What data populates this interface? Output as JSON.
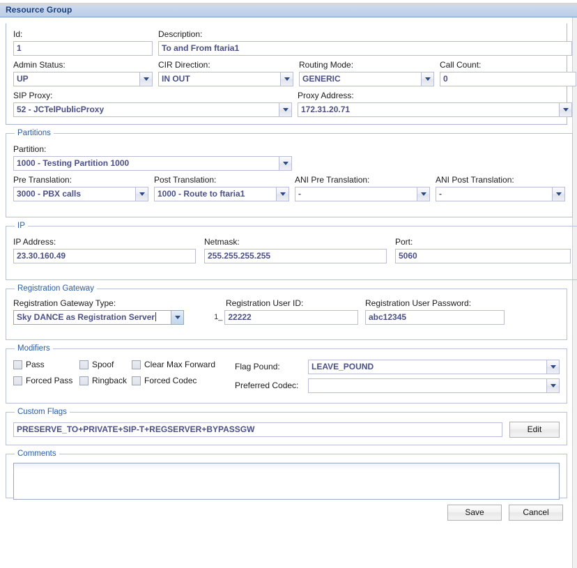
{
  "window": {
    "title": "Resource Group"
  },
  "top": {
    "id_label": "Id:",
    "id_value": "1",
    "description_label": "Description:",
    "description_value": "To and From ftaria1",
    "admin_status_label": "Admin Status:",
    "admin_status_value": "UP",
    "cir_direction_label": "CIR Direction:",
    "cir_direction_value": "IN OUT",
    "routing_mode_label": "Routing Mode:",
    "routing_mode_value": "GENERIC",
    "call_count_label": "Call Count:",
    "call_count_value": "0",
    "sip_proxy_label": "SIP Proxy:",
    "sip_proxy_value": "52 - JCTelPublicProxy",
    "proxy_address_label": "Proxy Address:",
    "proxy_address_value": "172.31.20.71"
  },
  "partitions": {
    "legend": "Partitions",
    "partition_label": "Partition:",
    "partition_value": "1000 - Testing Partition 1000",
    "pre_translation_label": "Pre Translation:",
    "pre_translation_value": "3000 - PBX calls",
    "post_translation_label": "Post Translation:",
    "post_translation_value": "1000 - Route to ftaria1",
    "ani_pre_translation_label": "ANI Pre Translation:",
    "ani_pre_translation_value": "-",
    "ani_post_translation_label": "ANI Post Translation:",
    "ani_post_translation_value": "-"
  },
  "ip": {
    "legend": "IP",
    "ip_address_label": "IP Address:",
    "ip_address_value": "23.30.160.49",
    "netmask_label": "Netmask:",
    "netmask_value": "255.255.255.255",
    "port_label": "Port:",
    "port_value": "5060"
  },
  "registration": {
    "legend": "Registration Gateway",
    "gateway_type_label": "Registration Gateway Type:",
    "gateway_type_value": "Sky DANCE as Registration Server",
    "user_id_label": "Registration User ID:",
    "user_id_prefix": "1_",
    "user_id_value": "22222",
    "user_password_label": "Registration User Password:",
    "user_password_value": "abc12345"
  },
  "modifiers": {
    "legend": "Modifiers",
    "checkboxes": [
      {
        "label": "Pass",
        "checked": false
      },
      {
        "label": "Spoof",
        "checked": false
      },
      {
        "label": "Clear Max Forward",
        "checked": false
      },
      {
        "label": "Forced Pass",
        "checked": false
      },
      {
        "label": "Ringback",
        "checked": false
      },
      {
        "label": "Forced Codec",
        "checked": false
      }
    ],
    "flag_pound_label": "Flag Pound:",
    "flag_pound_value": "LEAVE_POUND",
    "preferred_codec_label": "Preferred Codec:",
    "preferred_codec_value": ""
  },
  "custom_flags": {
    "legend": "Custom Flags",
    "value": "PRESERVE_TO+PRIVATE+SIP-T+REGSERVER+BYPASSGW",
    "edit_button": "Edit"
  },
  "comments": {
    "legend": "Comments",
    "value": ""
  },
  "footer": {
    "save_label": "Save",
    "cancel_label": "Cancel"
  },
  "colors": {
    "title_text": "#1a3f7a",
    "value_text": "#4a4f8c",
    "legend_text": "#2a5caa",
    "titlebar_bg": "#c6d5ea"
  }
}
